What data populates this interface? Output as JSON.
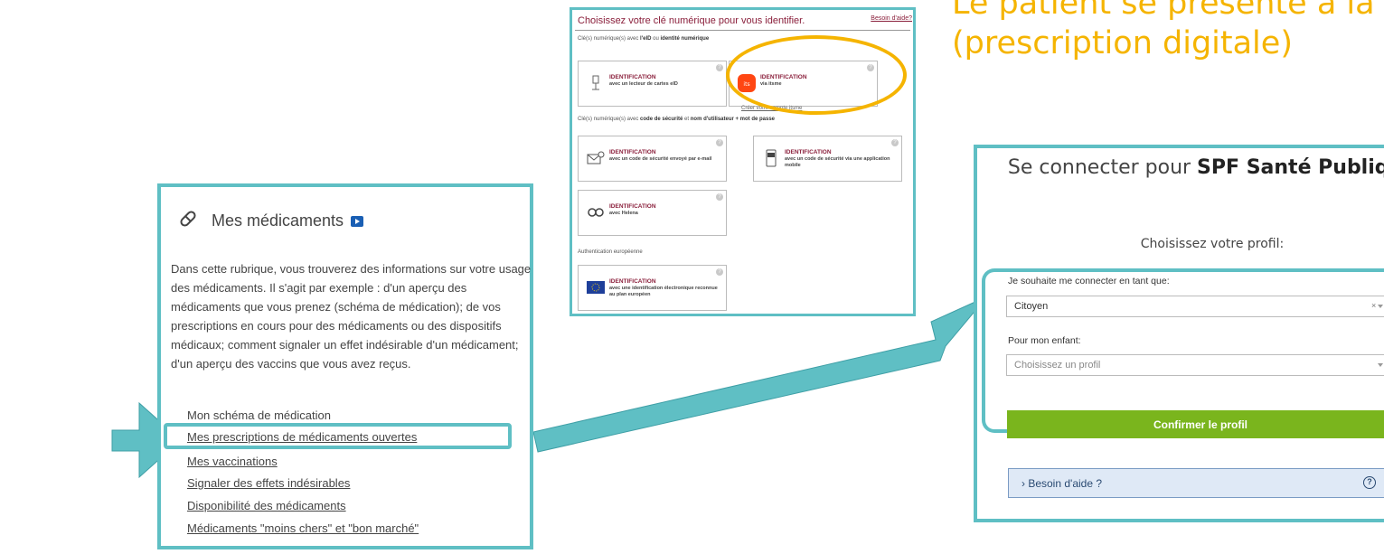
{
  "headline": {
    "line1": "Le patient se présente à la pr",
    "line2": "(prescription digitale)"
  },
  "eid_panel": {
    "title": "Choisissez votre clé numérique pour vous identifier.",
    "help_link": "Besoin d'aide?",
    "section1": {
      "prefix": "Clé(s) numérique(s) avec ",
      "b1": "l'eID",
      "mid": " ou ",
      "b2": "identité numérique"
    },
    "section2": {
      "prefix": "Clé(s) numérique(s) avec ",
      "b1": "code de sécurité",
      "mid": " et ",
      "b2": "nom d'utilisateur + mot de passe"
    },
    "section3": "Authentication européenne",
    "itsme_link": "Créer votre compte itsme",
    "cards": [
      {
        "title": "IDENTIFICATION",
        "subtitle": "avec un lecteur de cartes eID",
        "icon": "card-reader-icon"
      },
      {
        "title": "IDENTIFICATION",
        "subtitle": "via itsme",
        "icon": "itsme-icon"
      },
      {
        "title": "IDENTIFICATION",
        "subtitle": "avec un code de sécurité envoyé par e-mail",
        "icon": "email-code-icon"
      },
      {
        "title": "IDENTIFICATION",
        "subtitle": "avec un code de sécurité via une application mobile",
        "icon": "mobile-app-icon"
      },
      {
        "title": "IDENTIFICATION",
        "subtitle": "avec Helena",
        "icon": "helena-icon"
      },
      {
        "title": "IDENTIFICATION",
        "subtitle": "avec une identification électronique reconnue au plan européen",
        "icon": "eu-flag-icon"
      }
    ],
    "highlight_color": "#f5b400"
  },
  "meds_panel": {
    "title": "Mes médicaments",
    "description": "Dans cette rubrique, vous trouverez des informations sur votre usage des médicaments. Il s'agit par exemple : d'un aperçu des médicaments que vous prenez (schéma de médication); de vos prescriptions en cours pour des médicaments ou des dispositifs médicaux; comment signaler un effet indésirable d'un médicament; d'un aperçu des vaccins que vous avez reçus.",
    "links": [
      "Mon schéma de médication",
      "Mes prescriptions de médicaments ouvertes",
      "Mes vaccinations",
      "Signaler des effets indésirables",
      "Disponibilité des médicaments",
      "Médicaments \"moins chers\" et \"bon marché\""
    ],
    "highlighted_link": "Mes prescriptions de médicaments ouvertes"
  },
  "login_panel": {
    "heading_plain": "Se connecter pour ",
    "heading_bold": "SPF Santé Publique",
    "choose_profile": "Choisissez votre profil:",
    "label_role": "Je souhaite me connecter en tant que:",
    "role_value": "Citoyen",
    "clear_symbol": "×",
    "label_child": "Pour mon enfant:",
    "child_placeholder": "Choisissez un profil",
    "confirm_button": "Confirmer le profil",
    "help_label": "› Besoin d'aide ?",
    "help_icon_glyph": "?",
    "confirm_color": "#7ab51d"
  },
  "colors": {
    "frame": "#5fbfc4",
    "accent_yellow": "#f5b400",
    "eid_title": "#8a1f3b"
  }
}
